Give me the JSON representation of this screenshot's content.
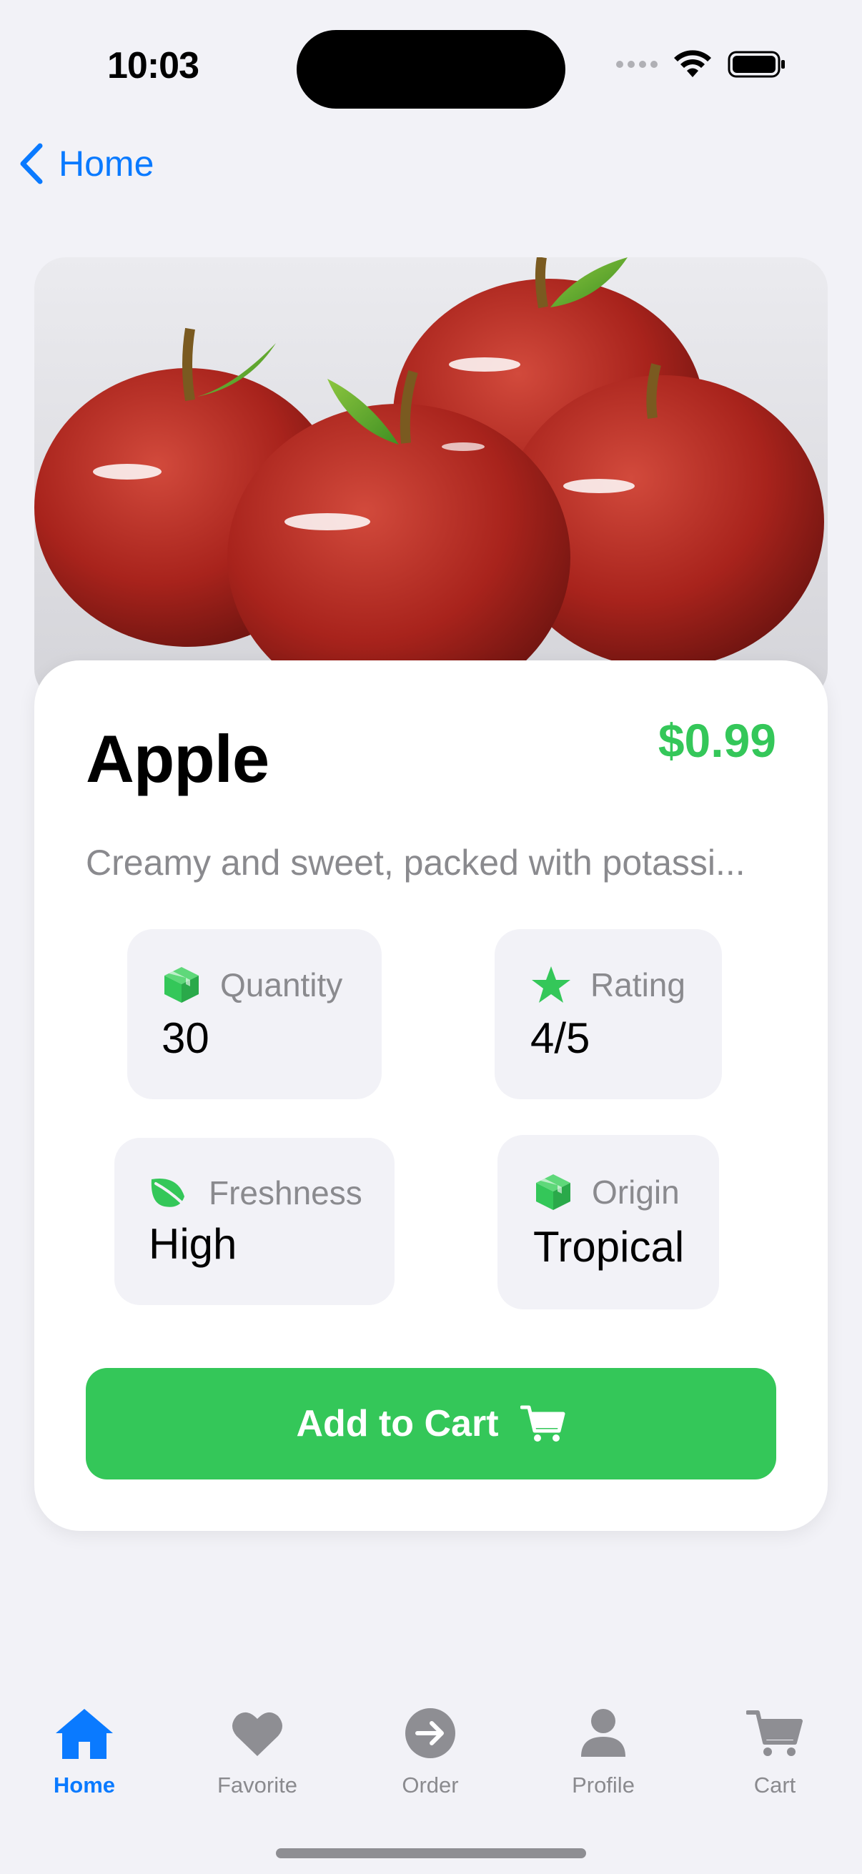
{
  "status_bar": {
    "time": "10:03"
  },
  "nav": {
    "back_label": "Home"
  },
  "product": {
    "name": "Apple",
    "price": "$0.99",
    "description": "Creamy and sweet, packed with potassi...",
    "image_icon": "apples-image"
  },
  "stats": [
    {
      "icon": "cube-icon",
      "label": "Quantity",
      "value": "30"
    },
    {
      "icon": "star-icon",
      "label": "Rating",
      "value": "4/5"
    },
    {
      "icon": "leaf-icon",
      "label": "Freshness",
      "value": "High"
    },
    {
      "icon": "cube-icon",
      "label": "Origin",
      "value": "Tropical"
    }
  ],
  "cta": {
    "label": "Add to Cart",
    "icon": "cart-icon"
  },
  "tabs": [
    {
      "label": "Home",
      "icon": "house-icon",
      "active": true
    },
    {
      "label": "Favorite",
      "icon": "heart-icon",
      "active": false
    },
    {
      "label": "Order",
      "icon": "arrow-circle-icon",
      "active": false
    },
    {
      "label": "Profile",
      "icon": "person-icon",
      "active": false
    },
    {
      "label": "Cart",
      "icon": "cart-icon",
      "active": false
    }
  ],
  "colors": {
    "accent": "#34c759",
    "link": "#0a7aff",
    "background": "#f2f2f7",
    "apple_red": "#a8231c"
  }
}
